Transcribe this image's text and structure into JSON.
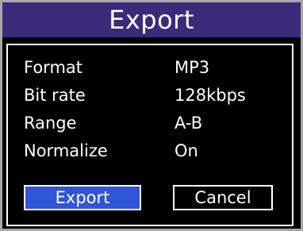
{
  "dialog": {
    "title": "Export",
    "settings": [
      {
        "label": "Format",
        "value": "MP3"
      },
      {
        "label": "Bit rate",
        "value": "128kbps"
      },
      {
        "label": "Range",
        "value": "A-B"
      },
      {
        "label": "Normalize",
        "value": "On"
      }
    ],
    "buttons": {
      "export_label": "Export",
      "cancel_label": "Cancel",
      "selected": "Export"
    }
  },
  "colors": {
    "title_bar": "#3a2a7a",
    "selected_button": "#2f55d8",
    "background": "#000000",
    "text": "#ffffff"
  }
}
